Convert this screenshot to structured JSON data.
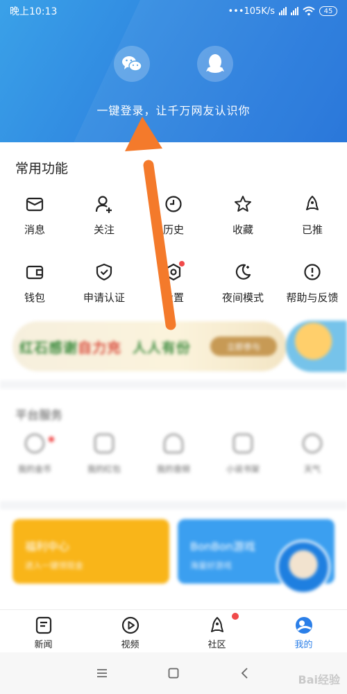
{
  "status_bar": {
    "time": "晚上10:13",
    "speed": "105K/s",
    "battery": "45"
  },
  "login": {
    "text": "一键登录，让千万网友认识你"
  },
  "common": {
    "title": "常用功能",
    "row1": [
      "消息",
      "关注",
      "历史",
      "收藏",
      "已推"
    ],
    "row2": [
      "钱包",
      "申请认证",
      "设置",
      "夜间模式",
      "帮助与反馈"
    ]
  },
  "banner": {
    "slogan_a": "红石感谢",
    "slogan_b": "自力充",
    "slogan_c": "人人有份",
    "button": "立即参与"
  },
  "platform": {
    "title": "平台服务",
    "items": [
      "我的金币",
      "我的红包",
      "我的音频",
      "小说书架",
      "天气"
    ]
  },
  "cards": {
    "welfare": {
      "title": "福利中心",
      "sub": "进入一键领现金"
    },
    "game": {
      "title": "BonBon游戏",
      "sub": "海量好游戏"
    }
  },
  "bottom_nav": {
    "items": [
      "新闻",
      "视频",
      "社区",
      "我的"
    ]
  },
  "colors": {
    "header_blue": "#2f86e0",
    "active_blue": "#2b7fe8",
    "arrow": "#f47a2b",
    "red_dot": "#f04a4a"
  },
  "watermark": "Bai经验"
}
